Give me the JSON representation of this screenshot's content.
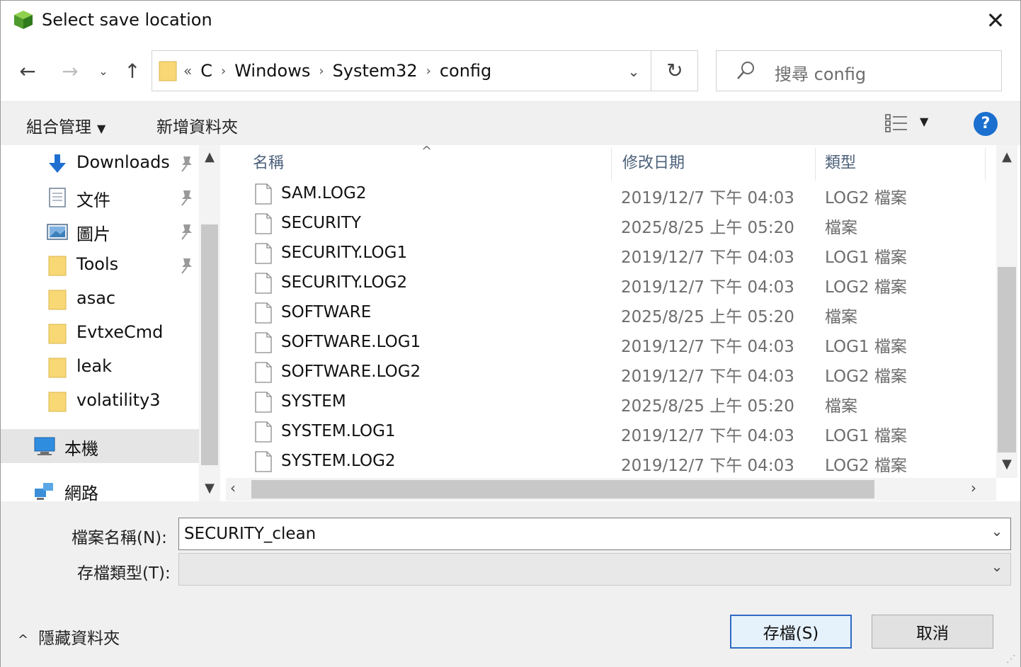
{
  "window": {
    "title": "Select save location",
    "close_glyph": "✕"
  },
  "nav": {
    "back": "←",
    "forward": "→",
    "recent": "⌄",
    "up": "↑"
  },
  "address": {
    "overflow": "«",
    "crumbs": [
      "C",
      "Windows",
      "System32",
      "config"
    ],
    "separator": "›",
    "dropdown": "⌄",
    "refresh": "↻"
  },
  "search": {
    "placeholder": "搜尋 config"
  },
  "toolbar": {
    "organize": "組合管理",
    "organize_caret": "▼",
    "new_folder": "新增資料夾",
    "view_caret": "▼",
    "help": "?"
  },
  "sidebar": {
    "items": [
      {
        "label": "Downloads",
        "icon": "download-icon",
        "pinned": true
      },
      {
        "label": "文件",
        "icon": "document-icon",
        "pinned": true
      },
      {
        "label": "圖片",
        "icon": "pictures-icon",
        "pinned": true
      },
      {
        "label": "Tools",
        "icon": "folder-icon",
        "pinned": true
      },
      {
        "label": "asac",
        "icon": "folder-icon",
        "pinned": false
      },
      {
        "label": "EvtxeCmd",
        "icon": "folder-icon",
        "pinned": false
      },
      {
        "label": "leak",
        "icon": "folder-icon",
        "pinned": false
      },
      {
        "label": "volatility3",
        "icon": "folder-icon",
        "pinned": false
      },
      {
        "label": "本機",
        "icon": "computer-icon",
        "selected": true
      },
      {
        "label": "網路",
        "icon": "network-icon"
      }
    ]
  },
  "filelist": {
    "columns": {
      "name": "名稱",
      "date": "修改日期",
      "type": "類型"
    },
    "sort_caret": "^",
    "rows": [
      {
        "name": "SAM.LOG2",
        "date": "2019/12/7 下午 04:03",
        "type": "LOG2 檔案"
      },
      {
        "name": "SECURITY",
        "date": "2025/8/25 上午 05:20",
        "type": "檔案"
      },
      {
        "name": "SECURITY.LOG1",
        "date": "2019/12/7 下午 04:03",
        "type": "LOG1 檔案"
      },
      {
        "name": "SECURITY.LOG2",
        "date": "2019/12/7 下午 04:03",
        "type": "LOG2 檔案"
      },
      {
        "name": "SOFTWARE",
        "date": "2025/8/25 上午 05:20",
        "type": "檔案"
      },
      {
        "name": "SOFTWARE.LOG1",
        "date": "2019/12/7 下午 04:03",
        "type": "LOG1 檔案"
      },
      {
        "name": "SOFTWARE.LOG2",
        "date": "2019/12/7 下午 04:03",
        "type": "LOG2 檔案"
      },
      {
        "name": "SYSTEM",
        "date": "2025/8/25 上午 05:20",
        "type": "檔案"
      },
      {
        "name": "SYSTEM.LOG1",
        "date": "2019/12/7 下午 04:03",
        "type": "LOG1 檔案"
      },
      {
        "name": "SYSTEM.LOG2",
        "date": "2019/12/7 下午 04:03",
        "type": "LOG2 檔案"
      }
    ]
  },
  "form": {
    "filename_label": "檔案名稱(N):",
    "filename_value": "SECURITY_clean",
    "filetype_label": "存檔類型(T):",
    "filetype_value": "",
    "dropdown": "⌄"
  },
  "footer": {
    "hide_folders": "隱藏資料夾",
    "hide_chevron": "^",
    "save": "存檔(S)",
    "cancel": "取消"
  },
  "colors": {
    "accent": "#1b6fce",
    "selection": "#e5e5e5",
    "folder": "#f8d775"
  }
}
